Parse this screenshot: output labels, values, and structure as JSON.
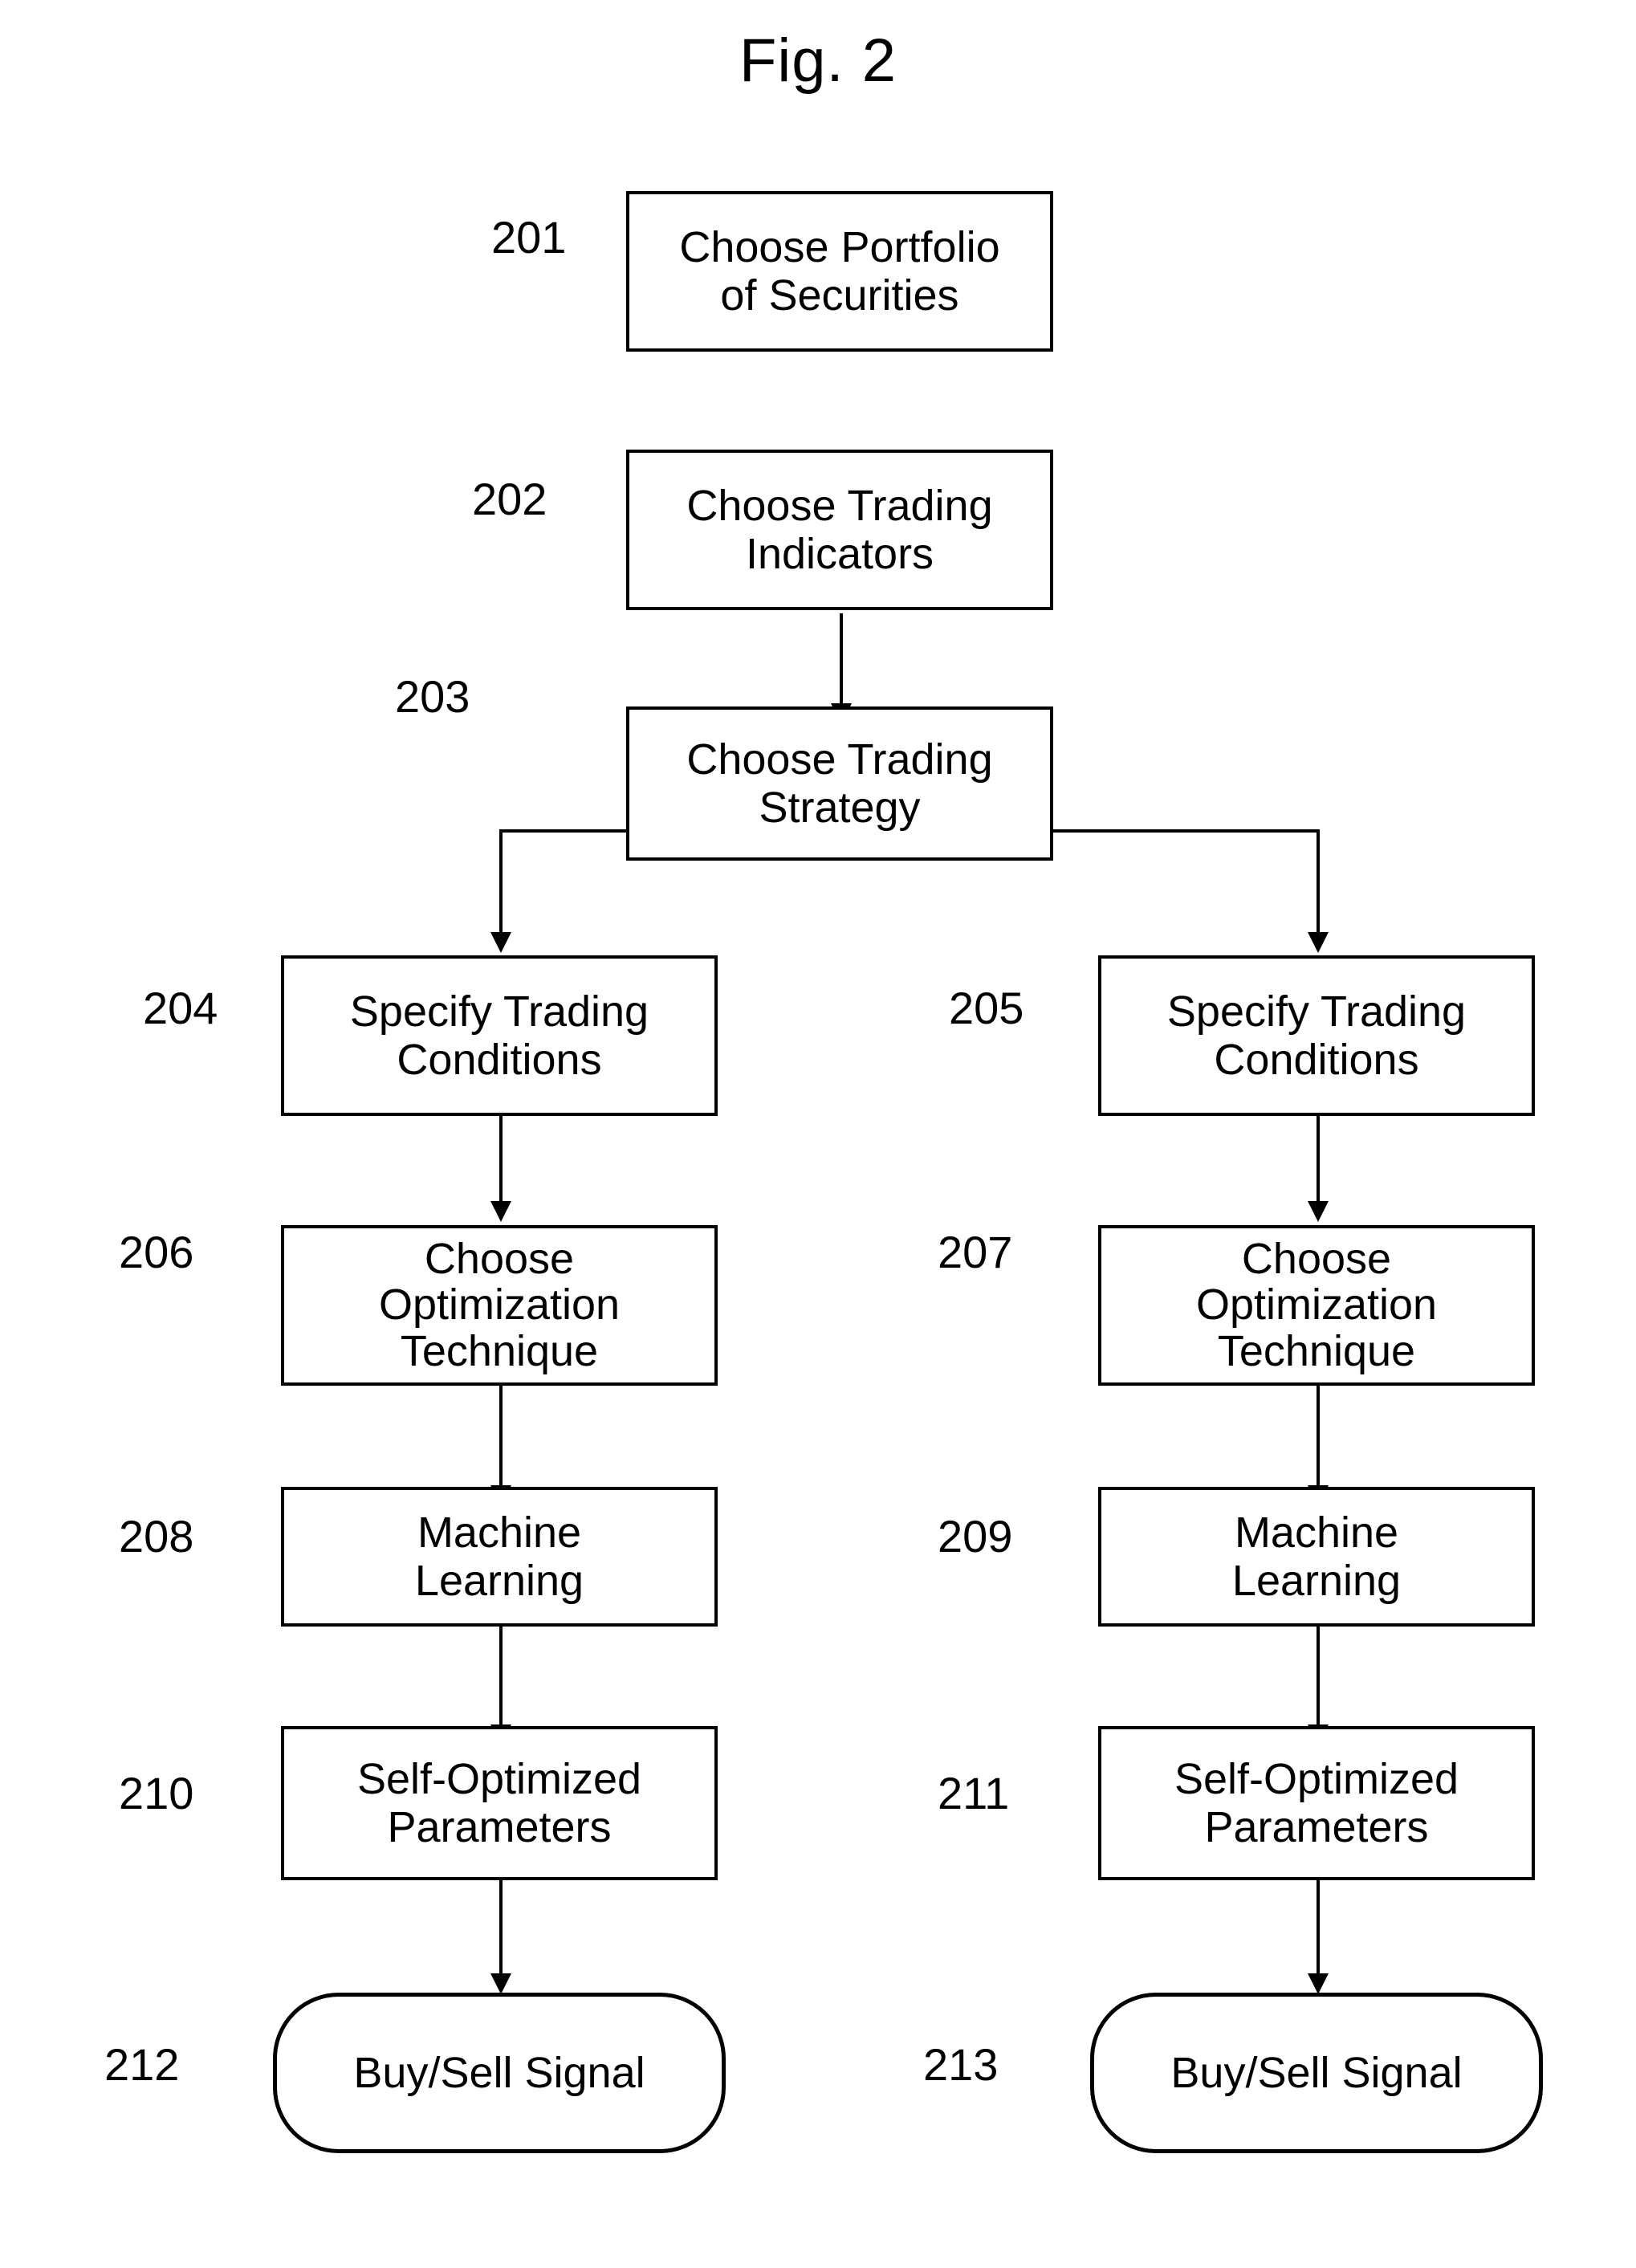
{
  "figure": {
    "title": "Fig. 2",
    "type": "flowchart",
    "ink_color": "#000000",
    "background_color": "#ffffff"
  },
  "nodes": [
    {
      "id": "201",
      "ref": "201",
      "shape": "rectangle",
      "lines": [
        "Choose Portfolio",
        "of Securities"
      ],
      "column": "trunk"
    },
    {
      "id": "202",
      "ref": "202",
      "shape": "rectangle",
      "lines": [
        "Choose Trading",
        "Indicators"
      ],
      "column": "trunk"
    },
    {
      "id": "203",
      "ref": "203",
      "shape": "rectangle",
      "lines": [
        "Choose Trading",
        "Strategy"
      ],
      "column": "trunk"
    },
    {
      "id": "204",
      "ref": "204",
      "shape": "rectangle",
      "lines": [
        "Specify Trading",
        "Conditions"
      ],
      "column": "left"
    },
    {
      "id": "205",
      "ref": "205",
      "shape": "rectangle",
      "lines": [
        "Specify Trading",
        "Conditions"
      ],
      "column": "right"
    },
    {
      "id": "206",
      "ref": "206",
      "shape": "rectangle",
      "lines": [
        "Choose",
        "Optimization",
        "Technique"
      ],
      "column": "left"
    },
    {
      "id": "207",
      "ref": "207",
      "shape": "rectangle",
      "lines": [
        "Choose",
        "Optimization",
        "Technique"
      ],
      "column": "right"
    },
    {
      "id": "208",
      "ref": "208",
      "shape": "rectangle",
      "lines": [
        "Machine",
        "Learning"
      ],
      "column": "left"
    },
    {
      "id": "209",
      "ref": "209",
      "shape": "rectangle",
      "lines": [
        "Machine",
        "Learning"
      ],
      "column": "right"
    },
    {
      "id": "210",
      "ref": "210",
      "shape": "rectangle",
      "lines": [
        "Self-Optimized",
        "Parameters"
      ],
      "column": "left"
    },
    {
      "id": "211",
      "ref": "211",
      "shape": "rectangle",
      "lines": [
        "Self-Optimized",
        "Parameters"
      ],
      "column": "right"
    },
    {
      "id": "212",
      "ref": "212",
      "shape": "rounded-terminal",
      "lines": [
        "Buy/Sell Signal"
      ],
      "column": "left"
    },
    {
      "id": "213",
      "ref": "213",
      "shape": "rounded-terminal",
      "lines": [
        "Buy/Sell Signal"
      ],
      "column": "right"
    }
  ],
  "edges": [
    {
      "from": "201",
      "to": "202",
      "style": "straight-arrow"
    },
    {
      "from": "202",
      "to": "203",
      "style": "straight-arrow"
    },
    {
      "from": "203",
      "to": "204",
      "style": "elbow-left-arrow"
    },
    {
      "from": "203",
      "to": "205",
      "style": "elbow-right-arrow"
    },
    {
      "from": "204",
      "to": "206",
      "style": "straight-arrow"
    },
    {
      "from": "205",
      "to": "207",
      "style": "straight-arrow"
    },
    {
      "from": "206",
      "to": "208",
      "style": "straight-arrow"
    },
    {
      "from": "207",
      "to": "209",
      "style": "straight-arrow"
    },
    {
      "from": "208",
      "to": "210",
      "style": "straight-arrow"
    },
    {
      "from": "209",
      "to": "211",
      "style": "straight-arrow"
    },
    {
      "from": "210",
      "to": "212",
      "style": "straight-arrow"
    },
    {
      "from": "211",
      "to": "213",
      "style": "straight-arrow"
    }
  ]
}
